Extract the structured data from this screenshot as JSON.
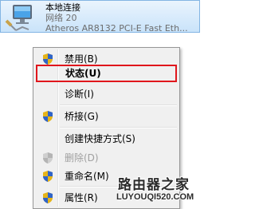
{
  "connection": {
    "name": "本地连接",
    "status": "网络 20",
    "device": "Atheros AR8132 PCI-E Fast Eth...",
    "icon": "network-adapter-icon"
  },
  "menu": {
    "items": [
      {
        "label": "禁用(B)",
        "icon": "uac-shield-icon",
        "bold": false,
        "disabled": false
      },
      {
        "label": "状态(U)",
        "icon": "",
        "bold": true,
        "disabled": false,
        "highlighted": true
      },
      {
        "label": "诊断(I)",
        "icon": "",
        "bold": false,
        "disabled": false
      },
      {
        "label": "桥接(G)",
        "icon": "uac-shield-icon",
        "bold": false,
        "disabled": false
      },
      {
        "label": "创建快捷方式(S)",
        "icon": "",
        "bold": false,
        "disabled": false
      },
      {
        "label": "删除(D)",
        "icon": "uac-shield-icon",
        "bold": false,
        "disabled": true
      },
      {
        "label": "重命名(M)",
        "icon": "uac-shield-icon",
        "bold": false,
        "disabled": false
      },
      {
        "label": "属性(R)",
        "icon": "uac-shield-icon",
        "bold": false,
        "disabled": false
      }
    ]
  },
  "watermark": {
    "cn": "路由器之家",
    "en": "LUYOUQI520.COM"
  },
  "colors": {
    "highlight_box": "#e0161c",
    "selection": "#c9e3fa",
    "menu_bg": "#f0f0f0"
  }
}
